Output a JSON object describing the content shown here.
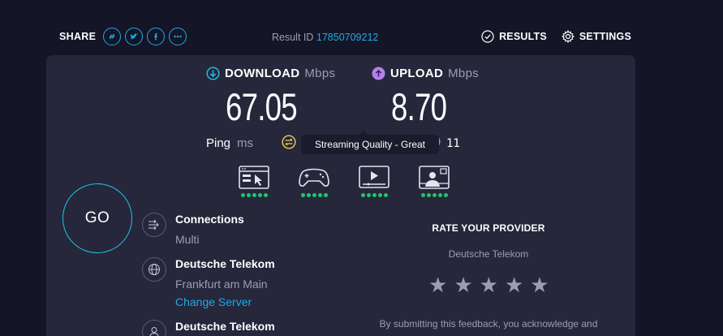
{
  "header": {
    "share_label": "SHARE",
    "share_icons": [
      "link-icon",
      "twitter-icon",
      "facebook-icon",
      "more-icon"
    ],
    "result_label": "Result ID",
    "result_id": "17850709212",
    "results_label": "RESULTS",
    "settings_label": "SETTINGS"
  },
  "download": {
    "label": "DOWNLOAD",
    "unit": "Mbps",
    "value": "67.05"
  },
  "upload": {
    "label": "UPLOAD",
    "unit": "Mbps",
    "value": "8.70"
  },
  "ping": {
    "label": "Ping",
    "unit": "ms",
    "partial_value": "11"
  },
  "tooltip": "Streaming Quality - Great",
  "quality_items": [
    {
      "icon": "browsing-icon",
      "rating": 5
    },
    {
      "icon": "gaming-icon",
      "rating": 5
    },
    {
      "icon": "streaming-icon",
      "rating": 5
    },
    {
      "icon": "video-call-icon",
      "rating": 5
    }
  ],
  "go_label": "GO",
  "connections": {
    "title": "Connections",
    "value": "Multi"
  },
  "server": {
    "title": "Deutsche Telekom",
    "location": "Frankfurt am Main",
    "change_label": "Change Server"
  },
  "isp": {
    "title": "Deutsche Telekom"
  },
  "rate": {
    "title": "RATE YOUR PROVIDER",
    "provider": "Deutsche Telekom",
    "stars": 5,
    "feedback_line1": "By submitting this feedback, you acknowledge and"
  },
  "colors": {
    "accent": "#1fa9e6",
    "download": "#1fc5e8",
    "upload": "#b77ff0",
    "quality": "#1fc66b",
    "ping_icon": "#e8d44d"
  }
}
